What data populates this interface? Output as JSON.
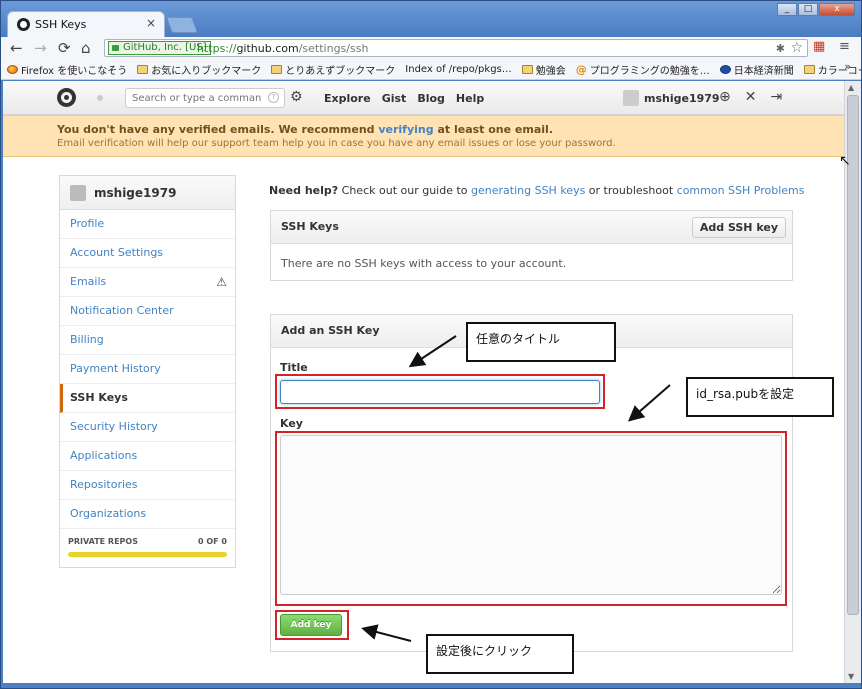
{
  "browser": {
    "tab_title": "SSH Keys",
    "tab_close": "×",
    "window_buttons": [
      "_",
      "□",
      "x"
    ],
    "ev_badge": "GitHub, Inc. [US]",
    "url_scheme": "https://",
    "url_host": "github.com",
    "url_path": "/settings/ssh",
    "bookmarks": [
      {
        "label": "Firefox を使いこなそう",
        "icon": "firefox-icon"
      },
      {
        "label": "お気に入りブックマーク",
        "icon": "folder-icon"
      },
      {
        "label": "とりあえずブックマーク",
        "icon": "folder-icon"
      },
      {
        "label": "Index of /repo/pkgs…",
        "icon": "page-icon"
      },
      {
        "label": "勉強会",
        "icon": "folder-icon"
      },
      {
        "label": "プログラミングの勉強を…",
        "icon": "at-icon"
      },
      {
        "label": "日本経済新聞",
        "icon": "nikkei-icon"
      },
      {
        "label": "カラーコード",
        "icon": "folder-icon"
      }
    ],
    "bookmarks_more": "»"
  },
  "header": {
    "search_placeholder": "Search or type a command",
    "nav": [
      "Explore",
      "Gist",
      "Blog",
      "Help"
    ],
    "username": "mshige1979"
  },
  "flash": {
    "line1_before": "You don't have any verified emails. We recommend ",
    "line1_link": "verifying",
    "line1_after": " at least one email.",
    "line2": "Email verification will help our support team help you in case you have any email issues or lose your password."
  },
  "sidebar": {
    "username": "mshige1979",
    "items": [
      {
        "label": "Profile"
      },
      {
        "label": "Account Settings"
      },
      {
        "label": "Emails"
      },
      {
        "label": "Notification Center"
      },
      {
        "label": "Billing"
      },
      {
        "label": "Payment History"
      },
      {
        "label": "SSH Keys"
      },
      {
        "label": "Security History"
      },
      {
        "label": "Applications"
      },
      {
        "label": "Repositories"
      },
      {
        "label": "Organizations"
      }
    ],
    "private_repos_label": "PRIVATE REPOS",
    "private_repos_count": "0 OF 0"
  },
  "main": {
    "help_bold": "Need help?",
    "help_text1": " Check out our guide to ",
    "help_link1": "generating SSH keys",
    "help_text2": " or troubleshoot ",
    "help_link2": "common SSH Problems",
    "ssh_keys_title": "SSH Keys",
    "add_ssh_key_button": "Add SSH key",
    "empty_message": "There are no SSH keys with access to your account.",
    "add_key_title": "Add an SSH Key",
    "title_label": "Title",
    "title_value": "",
    "key_label": "Key",
    "key_value": "",
    "add_key_button": "Add key"
  },
  "annotations": {
    "title_note": "任意のタイトル",
    "key_note": "id_rsa.pubを設定",
    "button_note": "設定後にクリック"
  },
  "colors": {
    "link": "#4183c4",
    "flash_bg": "#ffe3b4",
    "active_marker": "#d26911",
    "green_button": "#60b044",
    "annotation_red": "#d42424"
  }
}
